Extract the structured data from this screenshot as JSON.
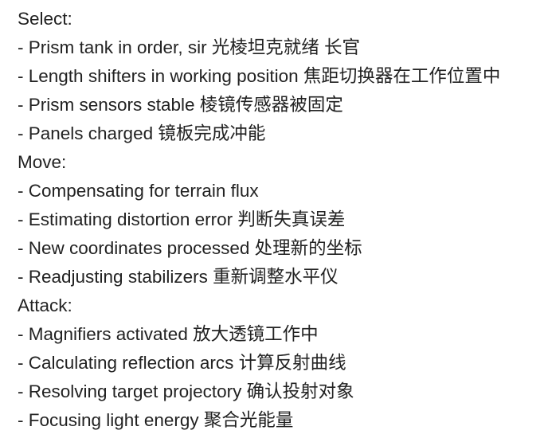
{
  "sections": [
    {
      "heading": "Select:",
      "items": [
        "- Prism tank in order, sir 光棱坦克就绪 长官",
        "- Length shifters in working position 焦距切换器在工作位置中",
        "- Prism sensors stable 棱镜传感器被固定",
        "- Panels charged 镜板完成冲能"
      ]
    },
    {
      "heading": "Move:",
      "items": [
        "- Compensating for terrain flux",
        "- Estimating distortion error 判断失真误差",
        "- New coordinates processed 处理新的坐标",
        "- Readjusting stabilizers 重新调整水平仪"
      ]
    },
    {
      "heading": "Attack:",
      "items": [
        "- Magnifiers activated 放大透镜工作中",
        "- Calculating reflection arcs 计算反射曲线",
        "- Resolving target projectory 确认投射对象",
        "- Focusing light energy 聚合光能量"
      ]
    }
  ]
}
